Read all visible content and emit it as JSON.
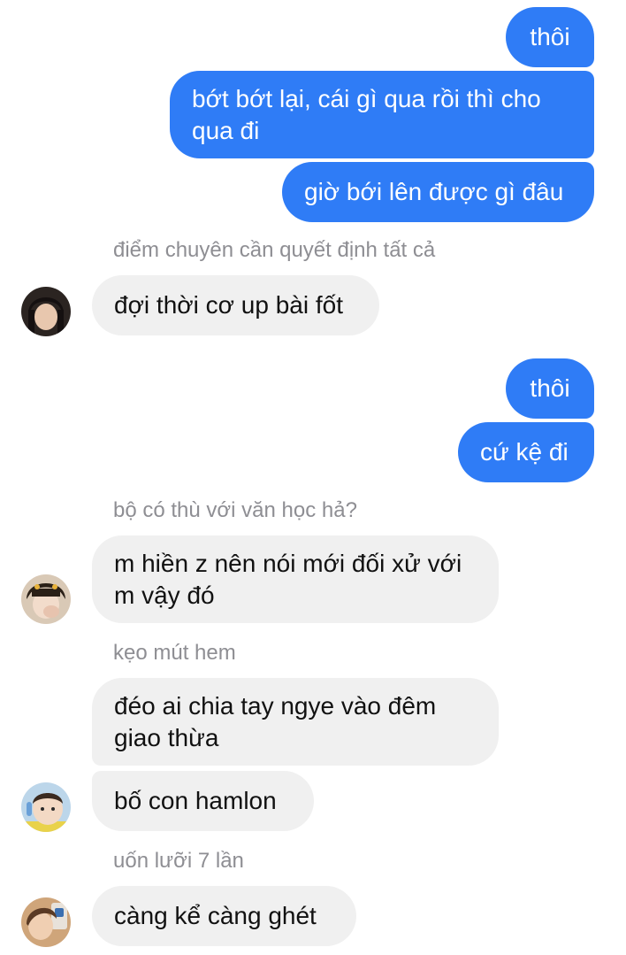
{
  "messages": {
    "m1": "thôi",
    "m2": "bớt bớt lại, cái gì qua rồi thì cho qua đi",
    "m3": "giờ bới lên được gì đâu",
    "m4": "đợi thời cơ up bài fốt",
    "m5": "thôi",
    "m6": "cứ kệ đi",
    "m7": "m hiền z nên nói mới đối xử với m vậy đó",
    "m8": "đéo ai chia tay ngye vào đêm giao thừa",
    "m9": "bố con hamlon",
    "m10": "càng kể càng ghét"
  },
  "names": {
    "n1": "điểm chuyên cần quyết định tất cả",
    "n2": "bộ có thù với văn học hả?",
    "n3": "kẹo mút hem",
    "n4": "uốn lưỡi 7 lần"
  },
  "colors": {
    "outgoing_bubble": "#2f7cf6",
    "incoming_bubble": "#f0f0f0",
    "sender_name": "#8e8e93"
  },
  "icons": [
    "avatar-dark-hair",
    "avatar-girl-hand",
    "avatar-baby",
    "avatar-selfie"
  ]
}
